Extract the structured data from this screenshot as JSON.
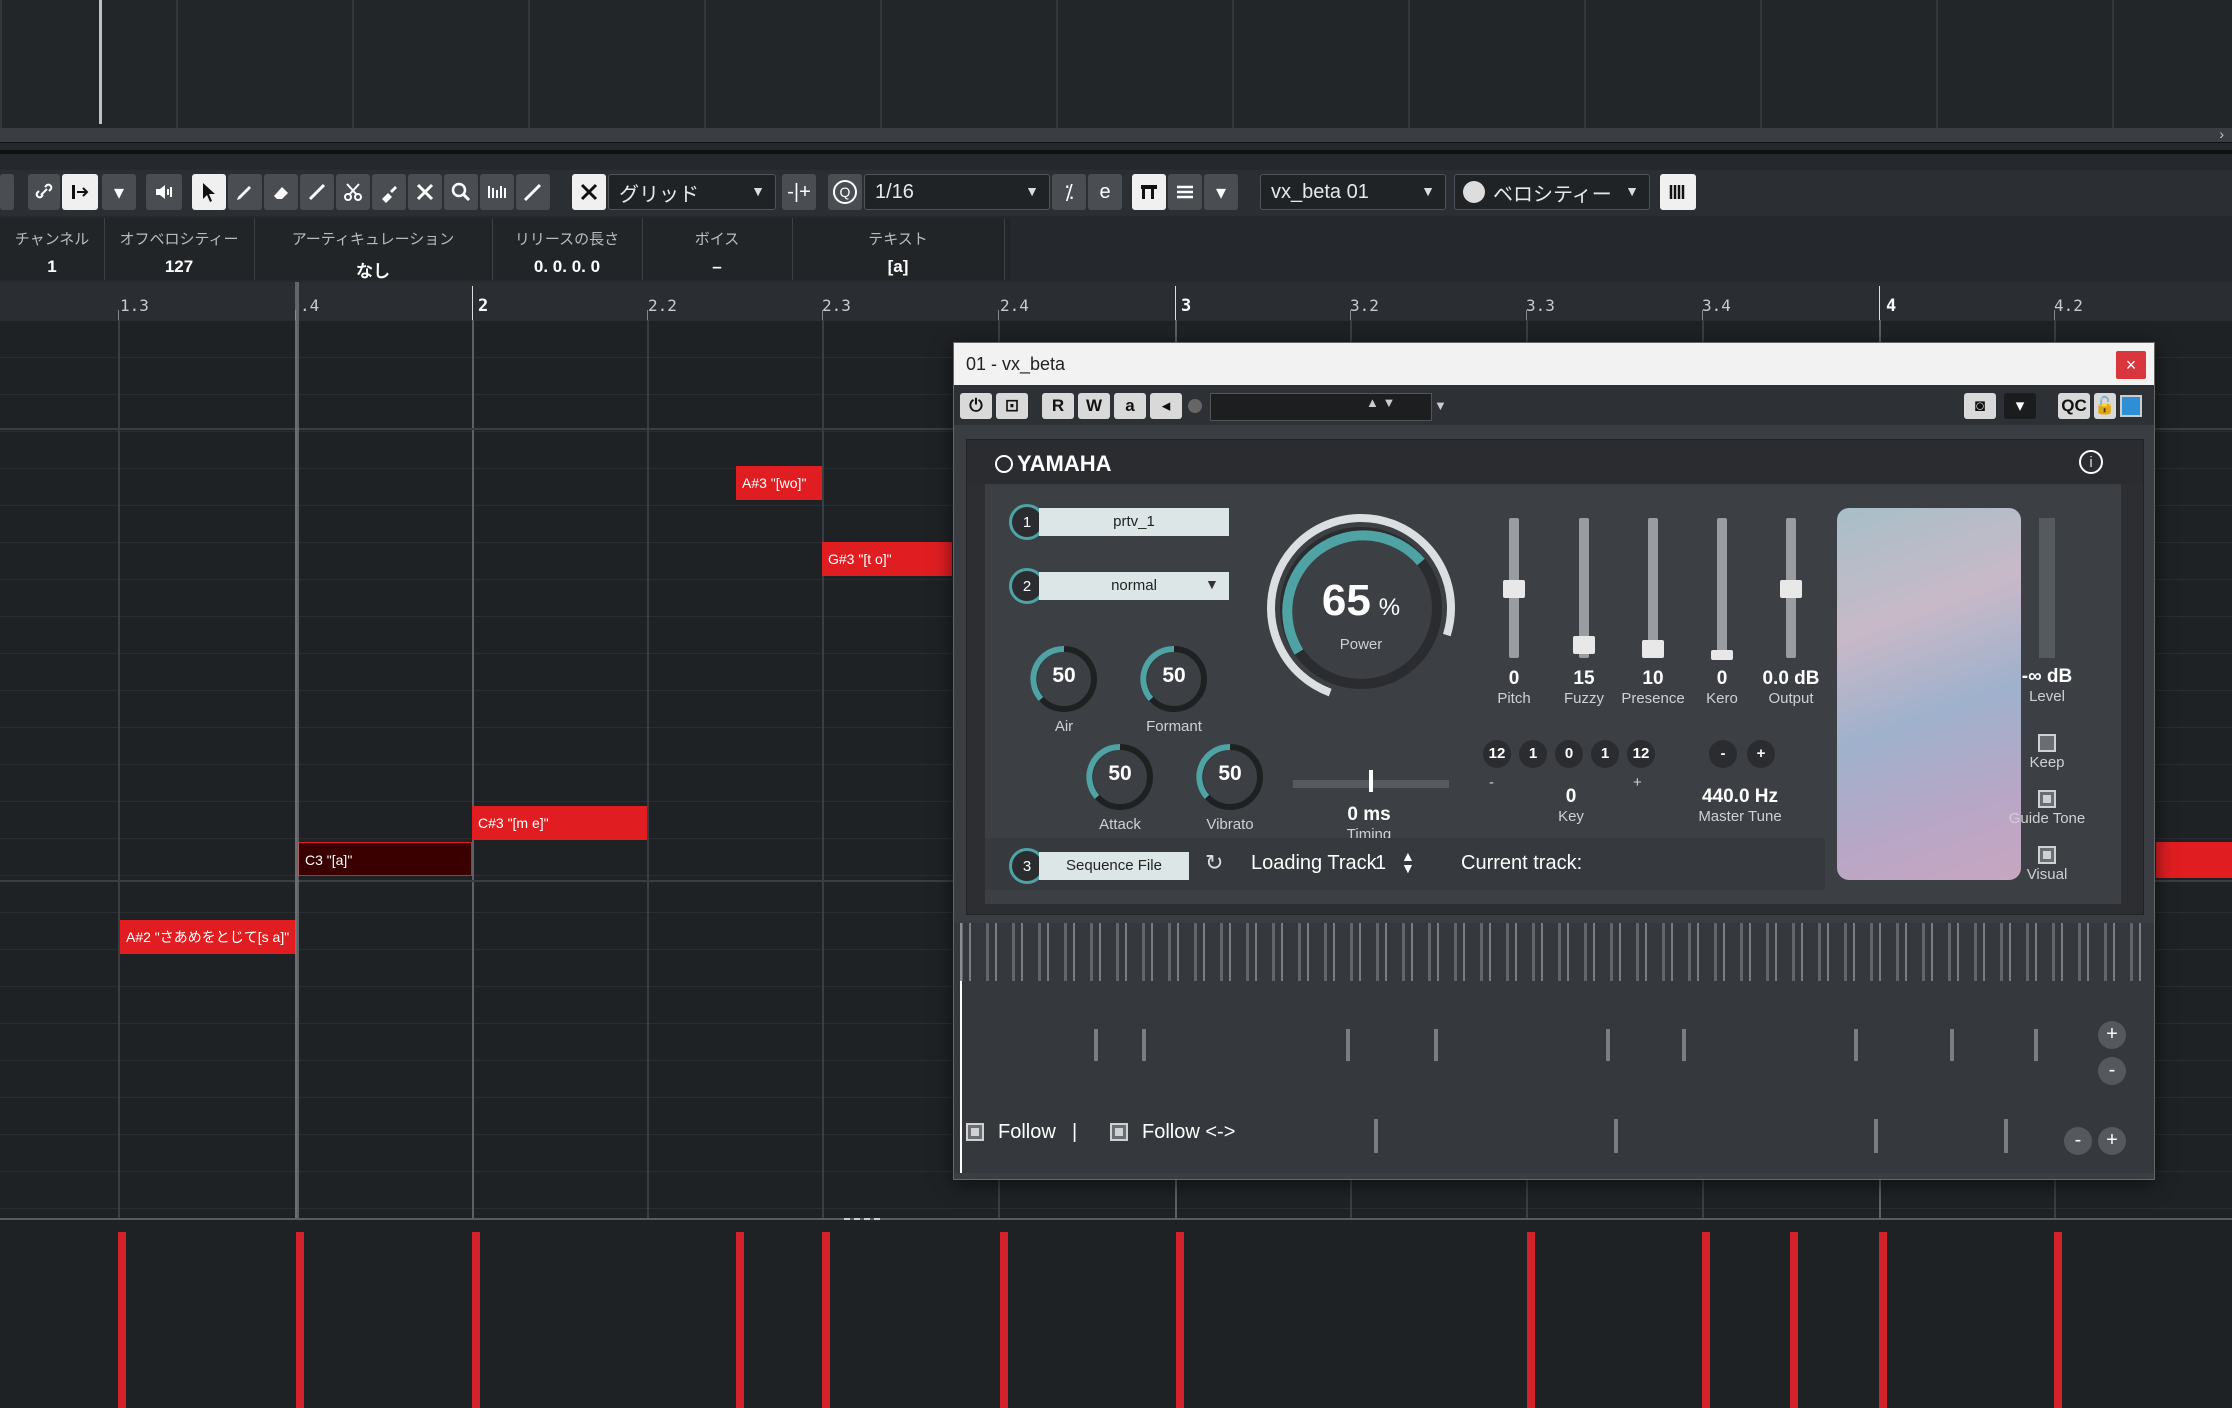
{
  "toolbar": {
    "snap_mode": "グリッド",
    "quantize_label": "Q",
    "quantize_value": "1/16",
    "track_select": "vx_beta 01",
    "lane_select": "ベロシティー"
  },
  "info_line": [
    {
      "header": "チャンネル",
      "value": "1"
    },
    {
      "header": "オフベロシティー",
      "value": "127"
    },
    {
      "header": "アーティキュレーション",
      "value": "なし"
    },
    {
      "header": "リリースの長さ",
      "value": "0. 0. 0.  0"
    },
    {
      "header": "ボイス",
      "value": "–"
    },
    {
      "header": "テキスト",
      "value": "[a]"
    }
  ],
  "ruler": [
    "1.3",
    ".4",
    "2",
    "2.2",
    "2.3",
    "2.4",
    "3",
    "3.2",
    "3.3",
    "3.4",
    "4",
    "4.2"
  ],
  "notes": [
    {
      "label": "A#3 \"[wo]\""
    },
    {
      "label": "G#3 \"[t o]\""
    },
    {
      "label": "C#3 \"[m e]\""
    },
    {
      "label": "C3 \"[a]\""
    },
    {
      "label": "A#2 \"さあめをとじて[s a]\""
    }
  ],
  "plugin": {
    "window_title": "01 - vx_beta",
    "close": "×",
    "tool_r": "R",
    "tool_w": "W",
    "tool_a": "a",
    "qc": "QC",
    "brand": "YAMAHA",
    "info_icon": "i",
    "tracks": [
      {
        "num": "1",
        "value": "prtv_1"
      },
      {
        "num": "2",
        "value": "normal"
      },
      {
        "num": "3",
        "value": "Sequence File"
      }
    ],
    "power_value": "65",
    "power_unit": "%",
    "power_label": "Power",
    "air": {
      "value": "50",
      "label": "Air"
    },
    "formant": {
      "value": "50",
      "label": "Formant"
    },
    "attack": {
      "value": "50",
      "label": "Attack"
    },
    "vibrato": {
      "value": "50",
      "label": "Vibrato"
    },
    "timing": {
      "value": "0 ms",
      "label": "Timing"
    },
    "sliders": [
      {
        "value": "0",
        "label": "Pitch"
      },
      {
        "value": "15",
        "label": "Fuzzy"
      },
      {
        "value": "10",
        "label": "Presence"
      },
      {
        "value": "0",
        "label": "Kero"
      },
      {
        "value": "0.0 dB",
        "label": "Output"
      }
    ],
    "key_pills": [
      "12",
      "1",
      "0",
      "1",
      "12"
    ],
    "key_minus": "-",
    "key_value": "0",
    "key_plus": "+",
    "key_label": "Key",
    "tune_minus": "-",
    "tune_plus": "+",
    "tune_value": "440.0 Hz",
    "tune_label": "Master Tune",
    "level_value": "-∞ dB",
    "level_label": "Level",
    "keep_label": "Keep",
    "guide_tone_label": "Guide Tone",
    "visual_label": "Visual",
    "loading_track_label": "Loading Track",
    "loading_track_value": "1",
    "current_track_label": "Current track:",
    "follow1": "Follow",
    "follow1_sep": "|",
    "follow2": "Follow <->",
    "zoom_plus": "+",
    "zoom_minus": "-"
  }
}
